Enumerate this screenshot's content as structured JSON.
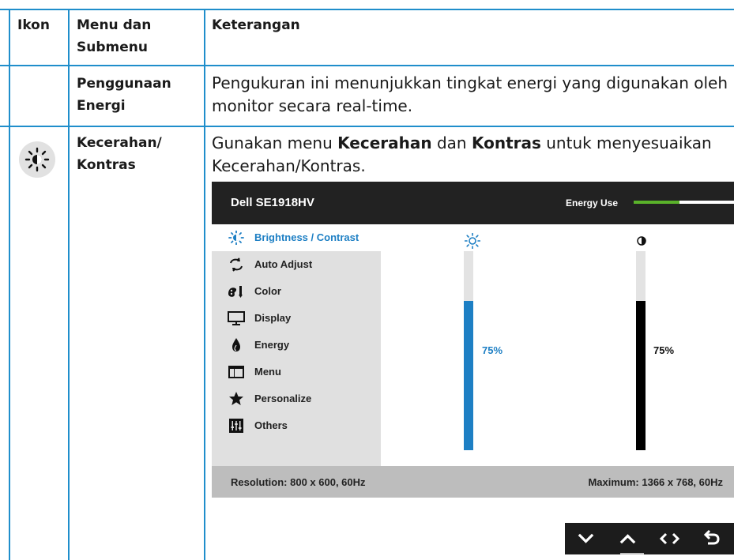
{
  "table": {
    "headers": {
      "icon": "Ikon",
      "menu": "Menu dan\nSubmenu",
      "desc": "Keterangan"
    },
    "rows": [
      {
        "menu": "Penggunaan\nEnergi",
        "desc": "Pengukuran ini menunjukkan tingkat energi yang digunakan oleh monitor secara real-time."
      },
      {
        "icon": "brightness-icon",
        "menu": "Kecerahan/\nKontras",
        "desc_parts": {
          "p1": "Gunakan menu ",
          "b1": "Kecerahan",
          "p2": " dan ",
          "b2": "Kontras",
          "p3": " untuk menyesuaikan Kecerahan/Kontras."
        }
      }
    ]
  },
  "osd": {
    "model": "Dell SE1918HV",
    "energy_label": "Energy Use",
    "energy_level": 0.46,
    "menu_items": [
      {
        "label": "Brightness / Contrast",
        "icon": "brightness-icon",
        "selected": true
      },
      {
        "label": "Auto Adjust",
        "icon": "auto-adjust-icon"
      },
      {
        "label": "Color",
        "icon": "color-icon"
      },
      {
        "label": "Display",
        "icon": "display-icon"
      },
      {
        "label": "Energy",
        "icon": "energy-icon"
      },
      {
        "label": "Menu",
        "icon": "menu-icon"
      },
      {
        "label": "Personalize",
        "icon": "star-icon"
      },
      {
        "label": "Others",
        "icon": "others-icon"
      }
    ],
    "brightness": {
      "value": 75,
      "label": "75%",
      "icon": "brightness-icon",
      "color": "#1d7fc4"
    },
    "contrast": {
      "value": 75,
      "label": "75%",
      "icon": "contrast-icon",
      "color": "#000000"
    },
    "resolution": "Resolution: 800 x 600, 60Hz",
    "maximum": "Maximum: 1366 x 768, 60Hz"
  },
  "buttons": [
    {
      "name": "down-button",
      "icon": "chevron-down-icon"
    },
    {
      "name": "up-button",
      "icon": "chevron-up-icon"
    },
    {
      "name": "select-button",
      "icon": "left-right-icon"
    },
    {
      "name": "back-button",
      "icon": "back-icon"
    }
  ],
  "colors": {
    "border": "#1f8ecb",
    "accent": "#1d7fc4",
    "energy_green": "#5ab22a"
  }
}
